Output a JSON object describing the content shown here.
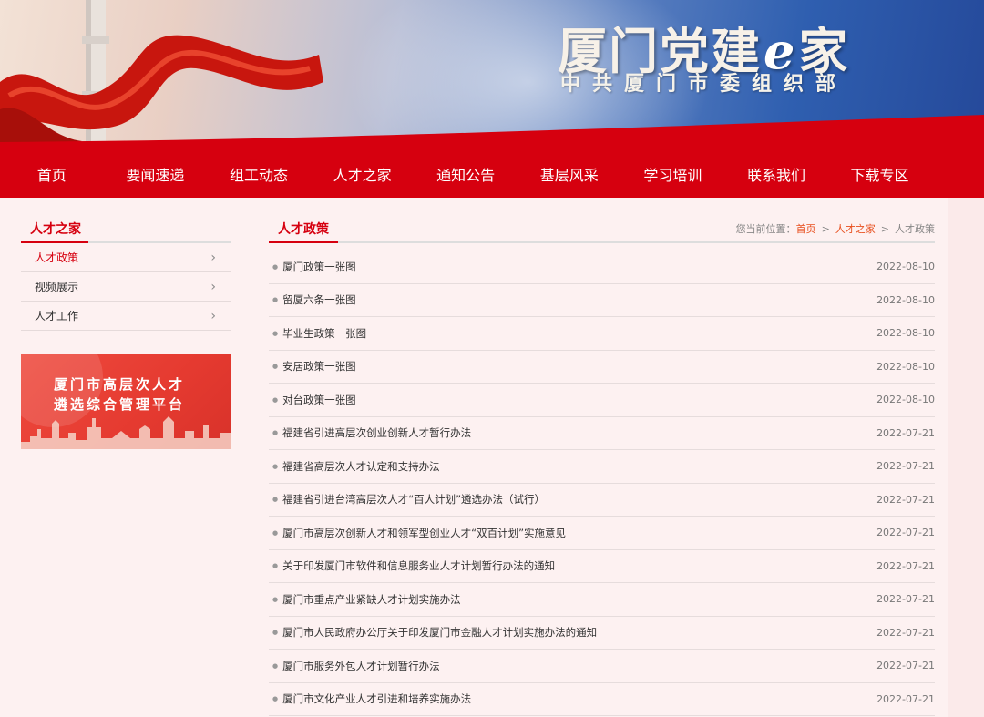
{
  "header": {
    "title_part1": "厦门党建",
    "title_e": "e",
    "title_part2": "家",
    "subtitle": "中共厦门市委组织部"
  },
  "nav": {
    "items": [
      "首页",
      "要闻速递",
      "组工动态",
      "人才之家",
      "通知公告",
      "基层风采",
      "学习培训",
      "联系我们",
      "下载专区"
    ]
  },
  "sidebar": {
    "heading": "人才之家",
    "items": [
      {
        "label": "人才政策",
        "active": true
      },
      {
        "label": "视频展示",
        "active": false
      },
      {
        "label": "人才工作",
        "active": false
      }
    ],
    "promo_line1": "厦门市高层次人才",
    "promo_line2": "遴选综合管理平台"
  },
  "content": {
    "heading": "人才政策",
    "breadcrumb": {
      "prefix": "您当前位置：",
      "home": "首页",
      "section": "人才之家",
      "current": "人才政策",
      "separator": ">"
    },
    "articles": [
      {
        "title": "厦门政策一张图",
        "date": "2022-08-10"
      },
      {
        "title": "留厦六条一张图",
        "date": "2022-08-10"
      },
      {
        "title": "毕业生政策一张图",
        "date": "2022-08-10"
      },
      {
        "title": "安居政策一张图",
        "date": "2022-08-10"
      },
      {
        "title": "对台政策一张图",
        "date": "2022-08-10"
      },
      {
        "title": "福建省引进高层次创业创新人才暂行办法",
        "date": "2022-07-21"
      },
      {
        "title": "福建省高层次人才认定和支持办法",
        "date": "2022-07-21"
      },
      {
        "title": "福建省引进台湾高层次人才“百人计划”遴选办法（试行）",
        "date": "2022-07-21"
      },
      {
        "title": "厦门市高层次创新人才和领军型创业人才“双百计划”实施意见",
        "date": "2022-07-21"
      },
      {
        "title": "关于印发厦门市软件和信息服务业人才计划暂行办法的通知",
        "date": "2022-07-21"
      },
      {
        "title": "厦门市重点产业紧缺人才计划实施办法",
        "date": "2022-07-21"
      },
      {
        "title": "厦门市人民政府办公厅关于印发厦门市金融人才计划实施办法的通知",
        "date": "2022-07-21"
      },
      {
        "title": "厦门市服务外包人才计划暂行办法",
        "date": "2022-07-21"
      },
      {
        "title": "厦门市文化产业人才引进和培养实施办法",
        "date": "2022-07-21"
      }
    ]
  },
  "colors": {
    "primary_red": "#d6000f",
    "accent_orange": "#e8501f",
    "page_bg": "#fdf1f1"
  },
  "icons": {
    "side_chevron": "chevron-right-icon",
    "list_bullet": "bullet-icon"
  }
}
